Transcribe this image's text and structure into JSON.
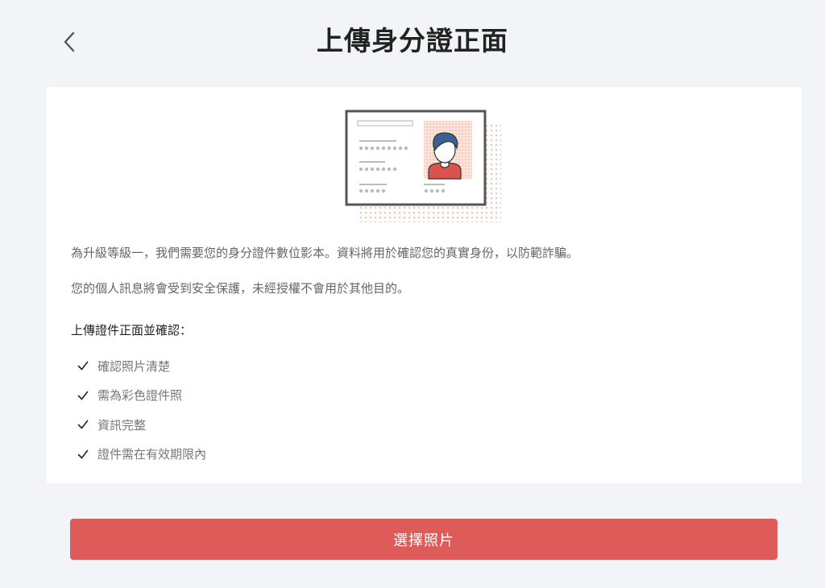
{
  "header": {
    "title": "上傳身分證正面",
    "back_icon": "chevron-left-icon"
  },
  "illustration": {
    "icon": "id-card-icon",
    "colors": {
      "frame": "#555555",
      "dots": "#f2b8a6",
      "hair": "#3c5f96",
      "shirt": "#d9534f",
      "photo_bg": "#fbe3da"
    }
  },
  "intro": {
    "line1": "為升級等級一，我們需要您的身分證件數位影本。資料將用於確認您的真實身份，以防範詐騙。",
    "line2": "您的個人訊息將會受到安全保護，未經授權不會用於其他目的。"
  },
  "checklist": {
    "title": "上傳證件正面並確認：",
    "items": [
      "確認照片清楚",
      "需為彩色證件照",
      "資訊完整",
      "證件需在有效期限內"
    ]
  },
  "footer": {
    "button_label": "選擇照片"
  },
  "colors": {
    "background": "#f2f4f8",
    "card": "#ffffff",
    "accent": "#dd5c5a"
  }
}
